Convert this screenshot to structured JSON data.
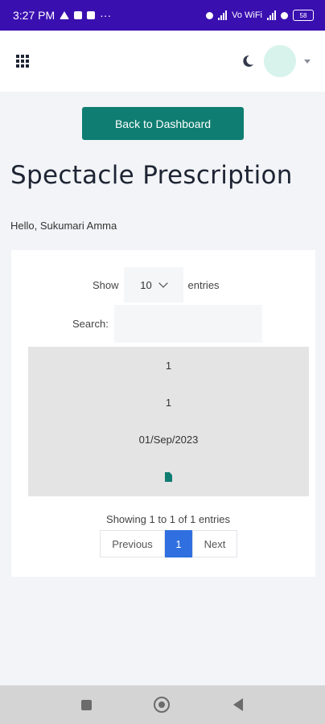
{
  "status_bar": {
    "time": "3:27 PM",
    "more": "···",
    "network": "Vo WiFi",
    "battery": "58"
  },
  "header": {
    "menu_icon": "grid-icon",
    "theme_icon": "moon-icon",
    "avatar_color": "#d7f3ec"
  },
  "main": {
    "back_button": "Back to Dashboard",
    "page_title": "Spectacle Prescription",
    "greeting": "Hello, Sukumari Amma"
  },
  "table": {
    "show_label": "Show",
    "entries_label": "entries",
    "page_size": "10",
    "search_label": "Search:",
    "search_value": "",
    "row": {
      "col1": "1",
      "col2": "1",
      "date": "01/Sep/2023",
      "action_icon": "document-icon"
    },
    "info": "Showing 1 to 1 of 1 entries",
    "pagination": {
      "previous": "Previous",
      "current": "1",
      "next": "Next"
    }
  },
  "colors": {
    "status_bar": "#3a0fb0",
    "accent": "#0f7d71",
    "page_active": "#2f6fe0"
  }
}
